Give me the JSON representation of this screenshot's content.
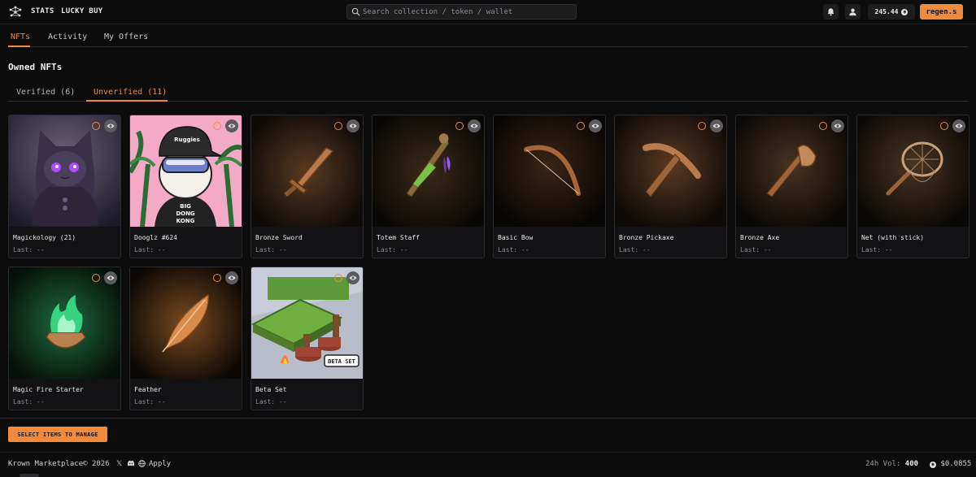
{
  "header": {
    "nav": [
      "STATS",
      "LUCKY BUY"
    ],
    "search_placeholder": "Search collection / token / wallet",
    "balance": "245.44",
    "user": "regen.s"
  },
  "tabs": [
    "NFTs",
    "Activity",
    "My Offers"
  ],
  "active_tab": "NFTs",
  "section_title": "Owned NFTs",
  "sub_tabs": [
    "Verified (6)",
    "Unverified (11)"
  ],
  "active_sub_tab": "Unverified (11)",
  "nfts": [
    {
      "name": "Magickology (21)",
      "last": "Last: --",
      "art": "cat-wizard"
    },
    {
      "name": "Dooglz #624",
      "last": "Last: --",
      "art": "dooglz"
    },
    {
      "name": "Bronze Sword",
      "last": "Last: --",
      "art": "sword"
    },
    {
      "name": "Totem Staff",
      "last": "Last: --",
      "art": "staff"
    },
    {
      "name": "Basic Bow",
      "last": "Last: --",
      "art": "bow"
    },
    {
      "name": "Bronze Pickaxe",
      "last": "Last: --",
      "art": "pickaxe"
    },
    {
      "name": "Bronze Axe",
      "last": "Last: --",
      "art": "axe"
    },
    {
      "name": "Net (with stick)",
      "last": "Last: --",
      "art": "net"
    },
    {
      "name": "Magic Fire Starter",
      "last": "Last: --",
      "art": "fire-starter"
    },
    {
      "name": "Feather",
      "last": "Last: --",
      "art": "feather"
    },
    {
      "name": "Beta Set",
      "last": "Last: --",
      "art": "beta-set"
    }
  ],
  "art_text": {
    "dooglz_cap": "Ruggies",
    "dooglz_shirt": [
      "BIG",
      "DONG",
      "KONG"
    ],
    "beta_badge": "BETA SET"
  },
  "manage_button": "SELECT ITEMS TO MANAGE",
  "footer": {
    "copyright": "Krown Marketplace© 2026",
    "apply": "Apply",
    "vol_label": "24h Vol:",
    "vol_value": "400",
    "price": "$0.0855"
  },
  "colors": {
    "accent": "#f08a3c",
    "background": "#0c0c0d",
    "card": "#121214"
  }
}
